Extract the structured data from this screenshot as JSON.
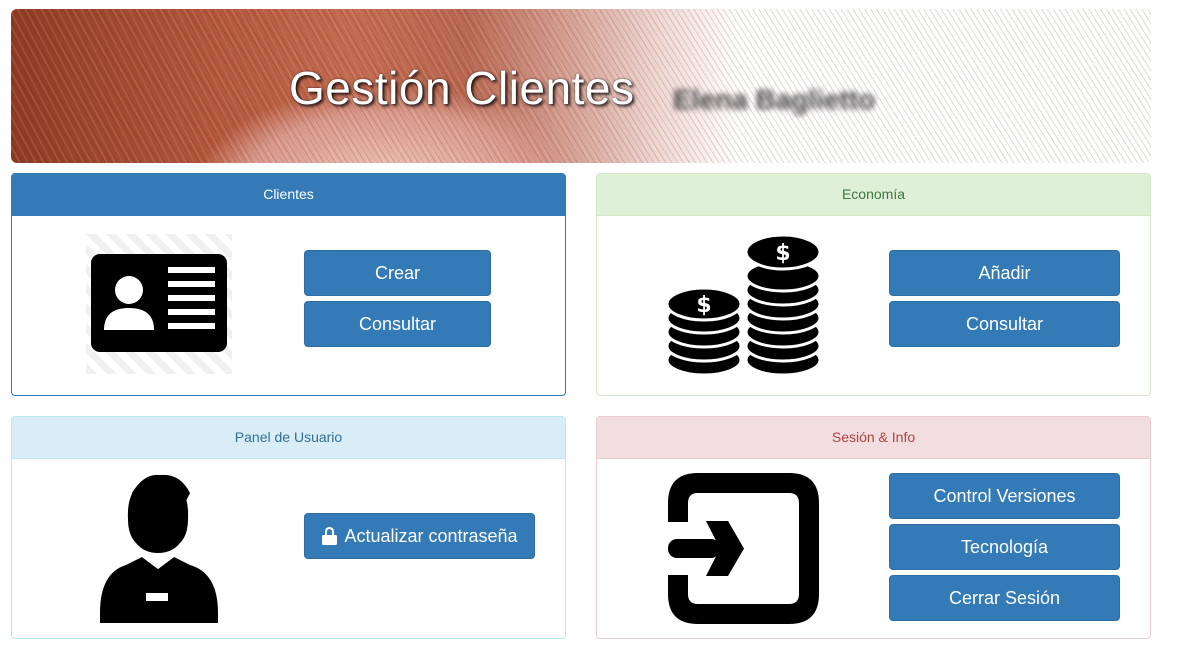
{
  "header": {
    "title": "Gestión Clientes",
    "user_name": "Elena Baglietto"
  },
  "panels": {
    "clientes": {
      "heading": "Clientes",
      "icon": "id-card-icon",
      "buttons": {
        "create": "Crear",
        "consult": "Consultar"
      }
    },
    "economia": {
      "heading": "Economía",
      "icon": "coins-icon",
      "buttons": {
        "add": "Añadir",
        "consult": "Consultar"
      }
    },
    "usuario": {
      "heading": "Panel de Usuario",
      "icon": "user-icon",
      "buttons": {
        "update_password": "Actualizar contraseña",
        "update_password_icon": "lock-icon"
      }
    },
    "sesion": {
      "heading": "Sesión & Info",
      "icon": "sign-in-icon",
      "buttons": {
        "versions": "Control Versiones",
        "technology": "Tecnología",
        "logout": "Cerrar Sesión"
      }
    }
  },
  "colors": {
    "primary": "#337ab7",
    "success_bg": "#dff0d8",
    "success_text": "#3c763d",
    "info_bg": "#d9edf7",
    "info_text": "#31708f",
    "danger_bg": "#f2dede",
    "danger_text": "#a94442"
  }
}
